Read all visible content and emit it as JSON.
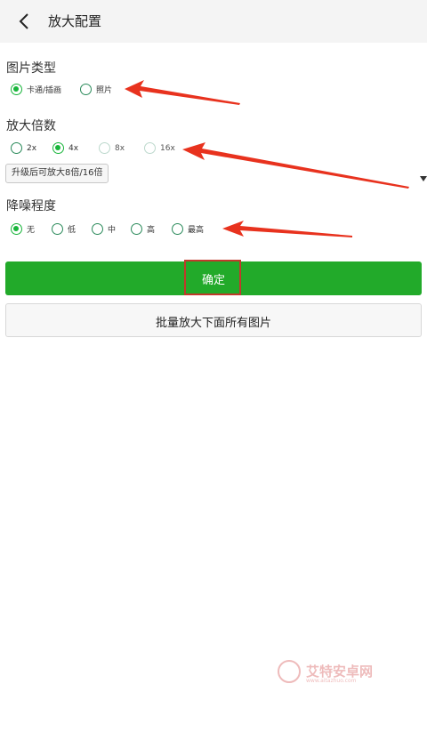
{
  "header": {
    "title": "放大配置"
  },
  "image_type": {
    "title": "图片类型",
    "options": [
      {
        "label": "卡通/插画",
        "checked": true
      },
      {
        "label": "照片",
        "checked": false
      }
    ]
  },
  "scale": {
    "title": "放大倍数",
    "options": [
      {
        "label": "2x",
        "checked": false
      },
      {
        "label": "4x",
        "checked": true
      },
      {
        "label": "8x",
        "checked": false,
        "disabled": true
      },
      {
        "label": "16x",
        "checked": false,
        "disabled": true
      }
    ],
    "upgrade_label": "升级后可放大8倍/16倍"
  },
  "noise": {
    "title": "降噪程度",
    "options": [
      {
        "label": "无",
        "checked": true
      },
      {
        "label": "低",
        "checked": false
      },
      {
        "label": "中",
        "checked": false
      },
      {
        "label": "高",
        "checked": false
      },
      {
        "label": "最高",
        "checked": false
      }
    ]
  },
  "actions": {
    "confirm_label": "确定",
    "batch_label": "批量放大下面所有图片"
  },
  "watermark": {
    "text": "艾特安卓网",
    "sub": "www.aitazhuo.com"
  },
  "colors": {
    "accent": "#22aa2a",
    "arrow": "#e8321e",
    "highlight": "#c0392b"
  },
  "icons": {
    "back": "chevron-left-icon"
  }
}
